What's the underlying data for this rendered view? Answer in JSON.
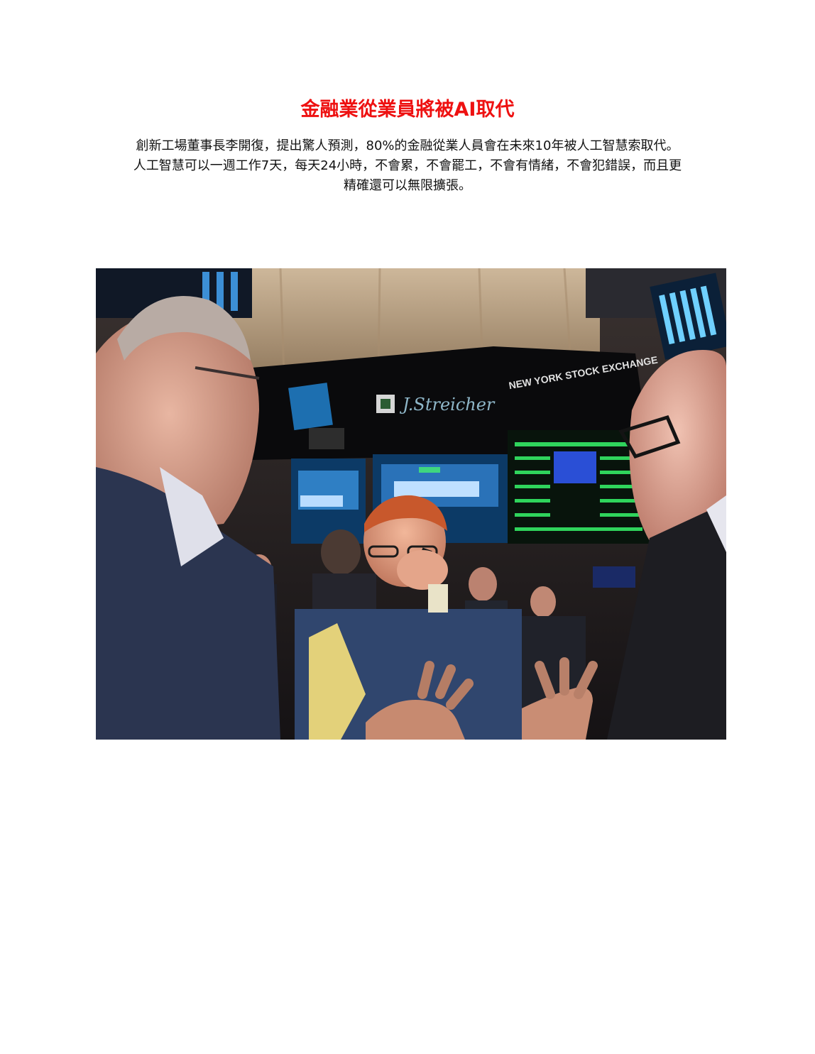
{
  "document": {
    "title": "金融業從業員將被AI取代",
    "body_lines": [
      "創新工場董事長李開復，提出驚人預測，80%的金融從業人員會在未來10年被人工智慧索取代。",
      "人工智慧可以一週工作7天，每天24小時，不會累，不會罷工，不會有情緒，不會犯錯誤，而且更",
      "精確還可以無限擴張。"
    ],
    "title_color": "#ee1111"
  },
  "photo": {
    "signage": {
      "logo_text": "J.Streicher",
      "exchange_text": "NEW YORK STOCK EXCHANGE"
    }
  }
}
